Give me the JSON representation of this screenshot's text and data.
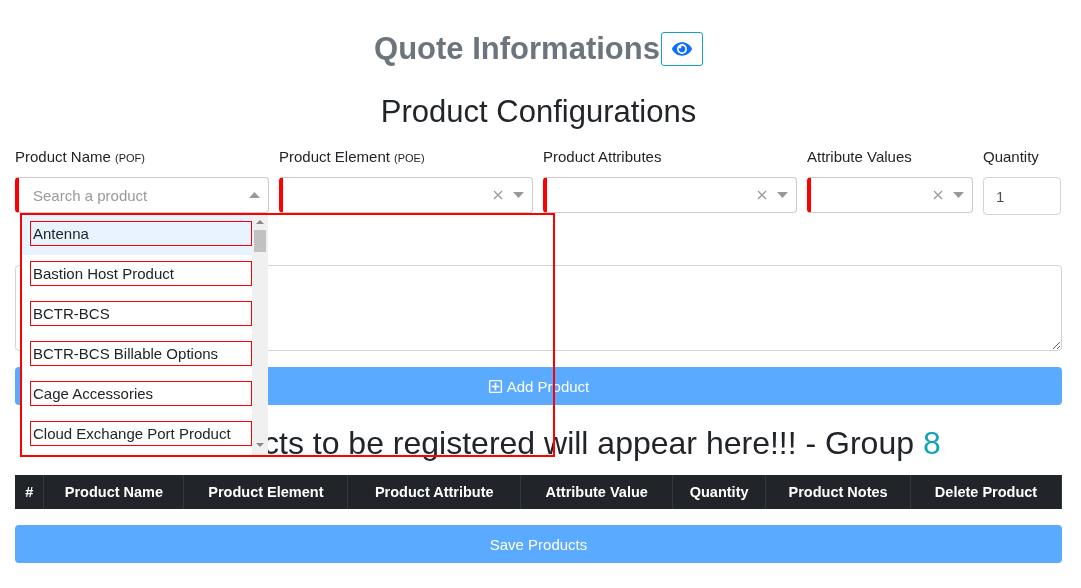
{
  "header": {
    "title": "Quote Informations"
  },
  "section_title": "Product Configurations",
  "fields": [
    {
      "kind": "search-select",
      "label": "Product Name",
      "hint": "(POF)",
      "placeholder": "Search a product",
      "expanded": true,
      "required": true
    },
    {
      "kind": "select",
      "label": "Product Element",
      "hint": "(POE)",
      "expanded": false,
      "required": true
    },
    {
      "kind": "select",
      "label": "Product Attributes",
      "expanded": false,
      "required": true
    },
    {
      "kind": "select",
      "label": "Attribute Values",
      "expanded": false,
      "required": true
    },
    {
      "kind": "number",
      "label": "Quantity",
      "value": "1",
      "required": false
    }
  ],
  "dropdown": {
    "options": [
      {
        "label": "Antenna",
        "selected": true
      },
      {
        "label": "Bastion Host Product",
        "selected": false
      },
      {
        "label": "BCTR-BCS",
        "selected": false
      },
      {
        "label": "BCTR-BCS Billable Options",
        "selected": false
      },
      {
        "label": "Cage Accessories",
        "selected": false
      },
      {
        "label": "Cloud Exchange Port Product",
        "selected": false
      }
    ]
  },
  "add_button": "Add Product",
  "list_heading": {
    "text": "cts to be registered will appear here!!! - Group",
    "group": "8"
  },
  "table": {
    "columns": [
      "#",
      "Product Name",
      "Product Element",
      "Product Attribute",
      "Attribute Value",
      "Quantity",
      "Product Notes",
      "Delete Product"
    ]
  },
  "save_button": "Save Products"
}
